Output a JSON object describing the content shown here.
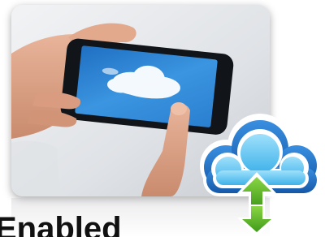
{
  "caption": {
    "text": "Enabled"
  },
  "photo": {
    "subject": "hand-holding-smartphone-with-cloud-screen"
  },
  "icons": {
    "cloud_sync": "cloud-sync-icon",
    "arrows": "up-down-arrow-icon"
  },
  "colors": {
    "cloud_outer": "#1d6fc4",
    "cloud_inner": "#6cc8f2",
    "arrow_green": "#5fbf2a",
    "screen_sky": "#2e86d6",
    "caption_text": "#111111"
  }
}
